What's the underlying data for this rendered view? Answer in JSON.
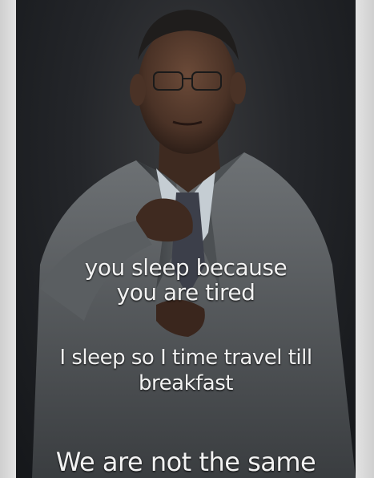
{
  "meme": {
    "caption_top": [
      "you sleep because",
      "you are tired"
    ],
    "caption_middle": [
      "I sleep so I time travel till",
      "breakfast"
    ],
    "caption_bottom": "We are not the same"
  }
}
